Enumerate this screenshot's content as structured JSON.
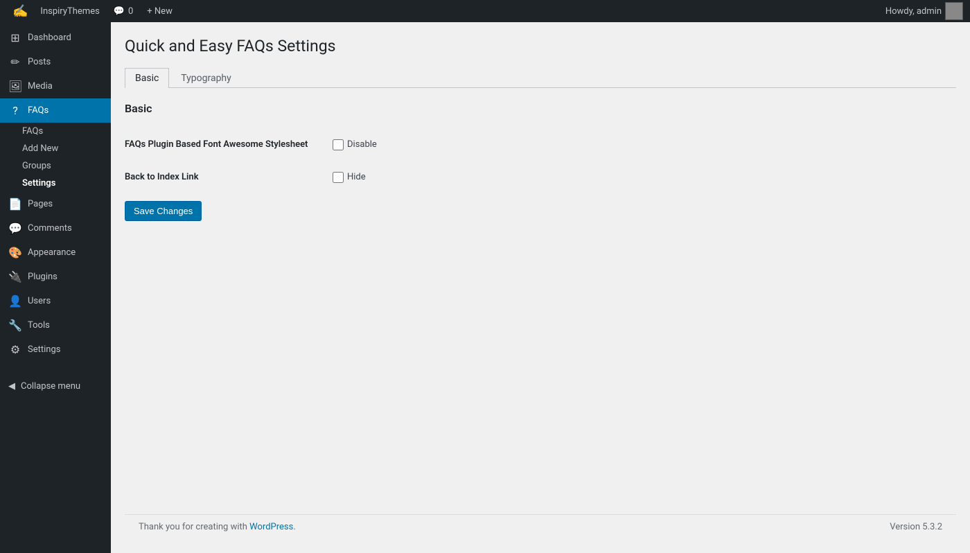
{
  "adminbar": {
    "wp_label": "WordPress",
    "site_name": "InspiryThemes",
    "comments_label": "Comments",
    "comments_count": "0",
    "new_label": "+ New",
    "howdy": "Howdy, admin"
  },
  "sidebar": {
    "items": [
      {
        "id": "dashboard",
        "label": "Dashboard",
        "icon": "⊞"
      },
      {
        "id": "posts",
        "label": "Posts",
        "icon": "📝"
      },
      {
        "id": "media",
        "label": "Media",
        "icon": "🖼"
      },
      {
        "id": "faqs",
        "label": "FAQs",
        "icon": "❓",
        "active": true
      },
      {
        "id": "pages",
        "label": "Pages",
        "icon": "📄"
      },
      {
        "id": "comments",
        "label": "Comments",
        "icon": "💬"
      },
      {
        "id": "appearance",
        "label": "Appearance",
        "icon": "🎨"
      },
      {
        "id": "plugins",
        "label": "Plugins",
        "icon": "🔌"
      },
      {
        "id": "users",
        "label": "Users",
        "icon": "👤"
      },
      {
        "id": "tools",
        "label": "Tools",
        "icon": "🔧"
      },
      {
        "id": "settings",
        "label": "Settings",
        "icon": "⚙"
      }
    ],
    "faqs_submenu": [
      {
        "id": "faqs-list",
        "label": "FAQs"
      },
      {
        "id": "faqs-add-new",
        "label": "Add New"
      },
      {
        "id": "faqs-groups",
        "label": "Groups"
      },
      {
        "id": "faqs-settings",
        "label": "Settings",
        "active": true
      }
    ],
    "collapse_label": "Collapse menu"
  },
  "page": {
    "title": "Quick and Easy FAQs Settings",
    "tabs": [
      {
        "id": "basic",
        "label": "Basic",
        "active": true
      },
      {
        "id": "typography",
        "label": "Typography"
      }
    ],
    "active_tab_heading": "Basic",
    "form": {
      "fields": [
        {
          "id": "font-awesome",
          "label": "FAQs Plugin Based Font Awesome Stylesheet",
          "checkbox_label": "Disable"
        },
        {
          "id": "back-to-index",
          "label": "Back to Index Link",
          "checkbox_label": "Hide"
        }
      ],
      "save_button": "Save Changes"
    }
  },
  "footer": {
    "thank_you_text": "Thank you for creating with ",
    "wp_link_label": "WordPress",
    "version_text": "Version 5.3.2"
  }
}
